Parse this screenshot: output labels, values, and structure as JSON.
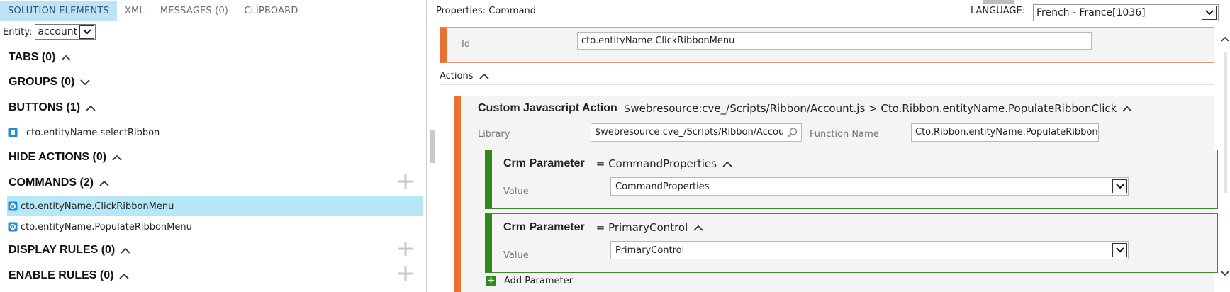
{
  "left_panel": {
    "tabs": [
      "SOLUTION ELEMENTS",
      "XML",
      "MESSAGES (0)",
      "CLIPBOARD"
    ],
    "active_tab": "SOLUTION ELEMENTS",
    "entity_label": "Entity:",
    "entity_value": "account",
    "sections": {
      "tabs": "TABS (0)",
      "groups": "GROUPS (0)",
      "buttons": "BUTTONS (1)",
      "hide_actions": "HIDE ACTIONS (0)",
      "commands": "COMMANDS (2)",
      "display_rules": "DISPLAY RULES (0)",
      "enable_rules": "ENABLE RULES (0)"
    },
    "button_items": [
      "cto.entityName.selectRibbon"
    ],
    "command_items": [
      "cto.entityName.ClickRibbonMenu",
      "cto.entityName.PopulateRibbonMenu"
    ],
    "selected_command": "cto.entityName.ClickRibbonMenu"
  },
  "right_panel": {
    "title": "Properties: Command",
    "language_label": "LANGUAGE:",
    "language_value": "French - France[1036]",
    "id_label": "Id",
    "id_value": "cto.entityName.ClickRibbonMenu",
    "actions_label": "Actions",
    "action": {
      "type_label": "Custom Javascript Action",
      "summary": "$webresource:cve_/Scripts/Ribbon/Account.js > Cto.Ribbon.entityName.PopulateRibbonClick",
      "library_label": "Library",
      "library_value": "$webresource:cve_/Scripts/Ribbon/Account.js",
      "function_label": "Function Name",
      "function_value": "Cto.Ribbon.entityName.PopulateRibbonClick"
    },
    "parameters": [
      {
        "type_label": "Crm Parameter",
        "summary": "= CommandProperties",
        "value_label": "Value",
        "value": "CommandProperties"
      },
      {
        "type_label": "Crm Parameter",
        "summary": "= PrimaryControl",
        "value_label": "Value",
        "value": "PrimaryControl"
      }
    ],
    "add_parameter_label": "Add Parameter"
  },
  "icons": {
    "collapse": "chevron-up-icon",
    "expand": "chevron-down-icon",
    "add": "plus-icon",
    "button_item": "button-icon",
    "command_item": "command-gear-icon",
    "search": "search-icon"
  },
  "colors": {
    "active_tab_bg": "#bde3f5",
    "selected_row_bg": "#b6e7f8",
    "command_accent": "#e8722f",
    "parameter_accent": "#2f8a1e",
    "icon_blue": "#1e8ed0"
  }
}
